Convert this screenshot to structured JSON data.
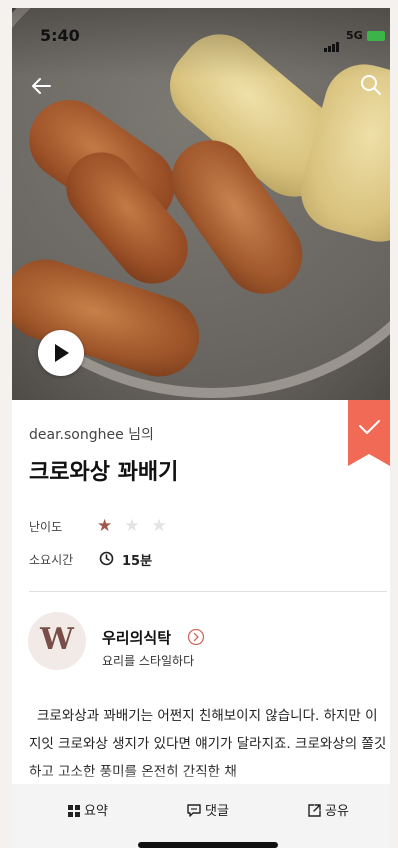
{
  "status_bar": {
    "time": "5:40",
    "network": "5G"
  },
  "recipe": {
    "author": "dear.songhee 님의",
    "title": "크로와상 꽈배기",
    "difficulty_label": "난이도",
    "difficulty_stars": {
      "filled": 1,
      "total": 3
    },
    "time_label": "소요시간",
    "time_value": "15분"
  },
  "channel": {
    "logo_letter": "W",
    "name": "우리의식탁",
    "subtitle": "요리를 스타일하다"
  },
  "description": "크로와상과 꽈배기는 어쩐지 친해보이지 않습니다. 하지만 이지잇 크로와상 생지가 있다면 얘기가 달라지죠. 크로와상의 쫄깃하고 고소한 풍미를 온전히 간직한 채",
  "tabs": {
    "summary": "요약",
    "comments": "댓글",
    "share": "공유"
  },
  "colors": {
    "bookmark": "#f06a55",
    "star_on": "#a0574a",
    "logo": "#7a4e48",
    "battery": "#3bb54a"
  },
  "icons": {
    "back": "arrow-left-icon",
    "search": "search-icon",
    "play": "play-icon",
    "bookmark": "bookmark-check-icon",
    "clock": "clock-icon",
    "channel_link": "chevron-right-circle-icon",
    "summary": "grid-icon",
    "comments": "comment-icon",
    "share": "share-icon"
  }
}
